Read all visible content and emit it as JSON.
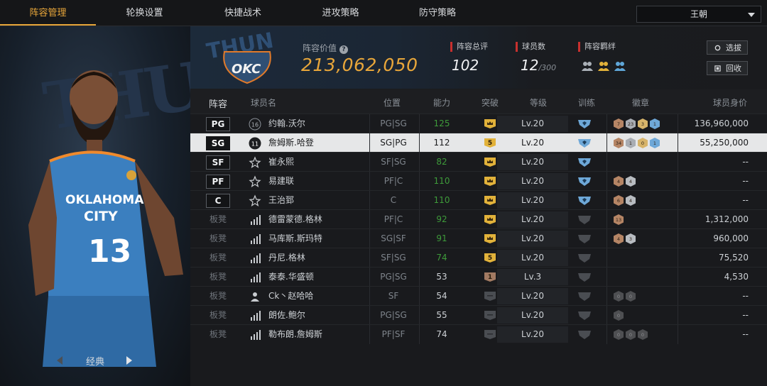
{
  "tabs": [
    "阵容管理",
    "轮换设置",
    "快捷战术",
    "进攻策略",
    "防守策略"
  ],
  "team_select": "王朝",
  "card_label": "经典",
  "header": {
    "value_label": "阵容价值",
    "value": "213,062,050",
    "rating_label": "阵容总评",
    "rating": "102",
    "count_label": "球员数",
    "count": "12",
    "count_max": "/300",
    "bond_label": "阵容羁绊",
    "btn_scout": "选拔",
    "btn_recycle": "回收"
  },
  "columns": [
    "阵容",
    "球员名",
    "位置",
    "能力",
    "突破",
    "等级",
    "训练",
    "徽章",
    "球员身价"
  ],
  "rows": [
    {
      "slot": "PG",
      "number": "16",
      "name": "约翰.沃尔",
      "pos": "PG|SG",
      "ability": "125",
      "brk": "crown",
      "level": "Lv.20",
      "train": "blue",
      "badges": [
        "7",
        "23",
        "3",
        "1"
      ],
      "value": "136,960,000"
    },
    {
      "slot": "SG",
      "number": "11",
      "name": "詹姆斯.哈登",
      "pos": "SG|PG",
      "ability": "112",
      "brk": "5",
      "level": "Lv.20",
      "train": "blue",
      "badges": [
        "34",
        "1",
        "0",
        "1"
      ],
      "value": "55,250,000"
    },
    {
      "slot": "SF",
      "number": "",
      "name": "崔永熙",
      "pos": "SF|SG",
      "ability": "82",
      "brk": "crown",
      "level": "Lv.20",
      "train": "blue",
      "badges": [],
      "value": "--"
    },
    {
      "slot": "PF",
      "number": "",
      "name": "易建联",
      "pos": "PF|C",
      "ability": "110",
      "brk": "crown",
      "level": "Lv.20",
      "train": "blue",
      "badges": [
        "4",
        "4"
      ],
      "value": "--"
    },
    {
      "slot": "C",
      "number": "",
      "name": "王治郅",
      "pos": "C",
      "ability": "110",
      "brk": "crown",
      "level": "Lv.20",
      "train": "blue",
      "badges": [
        "6",
        "4"
      ],
      "value": "--"
    },
    {
      "slot": "板凳",
      "number": "",
      "name": "德雷蒙德.格林",
      "pos": "PF|C",
      "ability": "92",
      "brk": "crown",
      "level": "Lv.20",
      "train": "gray",
      "badges": [
        "13"
      ],
      "value": "1,312,000"
    },
    {
      "slot": "板凳",
      "number": "",
      "name": "马库斯.斯玛特",
      "pos": "SG|SF",
      "ability": "91",
      "brk": "crown",
      "level": "Lv.20",
      "train": "gray",
      "badges": [
        "4",
        "3"
      ],
      "value": "960,000"
    },
    {
      "slot": "板凳",
      "number": "",
      "name": "丹尼.格林",
      "pos": "SF|SG",
      "ability": "74",
      "brk": "5",
      "level": "Lv.20",
      "train": "gray",
      "badges": [],
      "value": "75,520"
    },
    {
      "slot": "板凳",
      "number": "",
      "name": "泰泰.华盛顿",
      "pos": "PG|SG",
      "ability": "53",
      "brk": "1",
      "level": "Lv.3",
      "train": "gray",
      "badges": [],
      "value": "4,530"
    },
    {
      "slot": "板凳",
      "number": "",
      "name": "Ck丶赵哈哈",
      "pos": "SF",
      "ability": "54",
      "brk": "none",
      "level": "Lv.20",
      "train": "gray",
      "badges": [
        "0",
        "0"
      ],
      "value": "--"
    },
    {
      "slot": "板凳",
      "number": "",
      "name": "朗佐.鲍尔",
      "pos": "PG|SG",
      "ability": "55",
      "brk": "none",
      "level": "Lv.20",
      "train": "gray",
      "badges": [
        "0"
      ],
      "value": "--"
    },
    {
      "slot": "板凳",
      "number": "",
      "name": "勒布朗.詹姆斯",
      "pos": "PF|SF",
      "ability": "74",
      "brk": "none",
      "level": "Lv.20",
      "train": "gray",
      "badges": [
        "0",
        "0",
        "0"
      ],
      "value": "--"
    }
  ],
  "colors": {
    "accent": "#e8a63a",
    "ability_green": "#3e9b3a",
    "tag_red": "#c8302e"
  }
}
